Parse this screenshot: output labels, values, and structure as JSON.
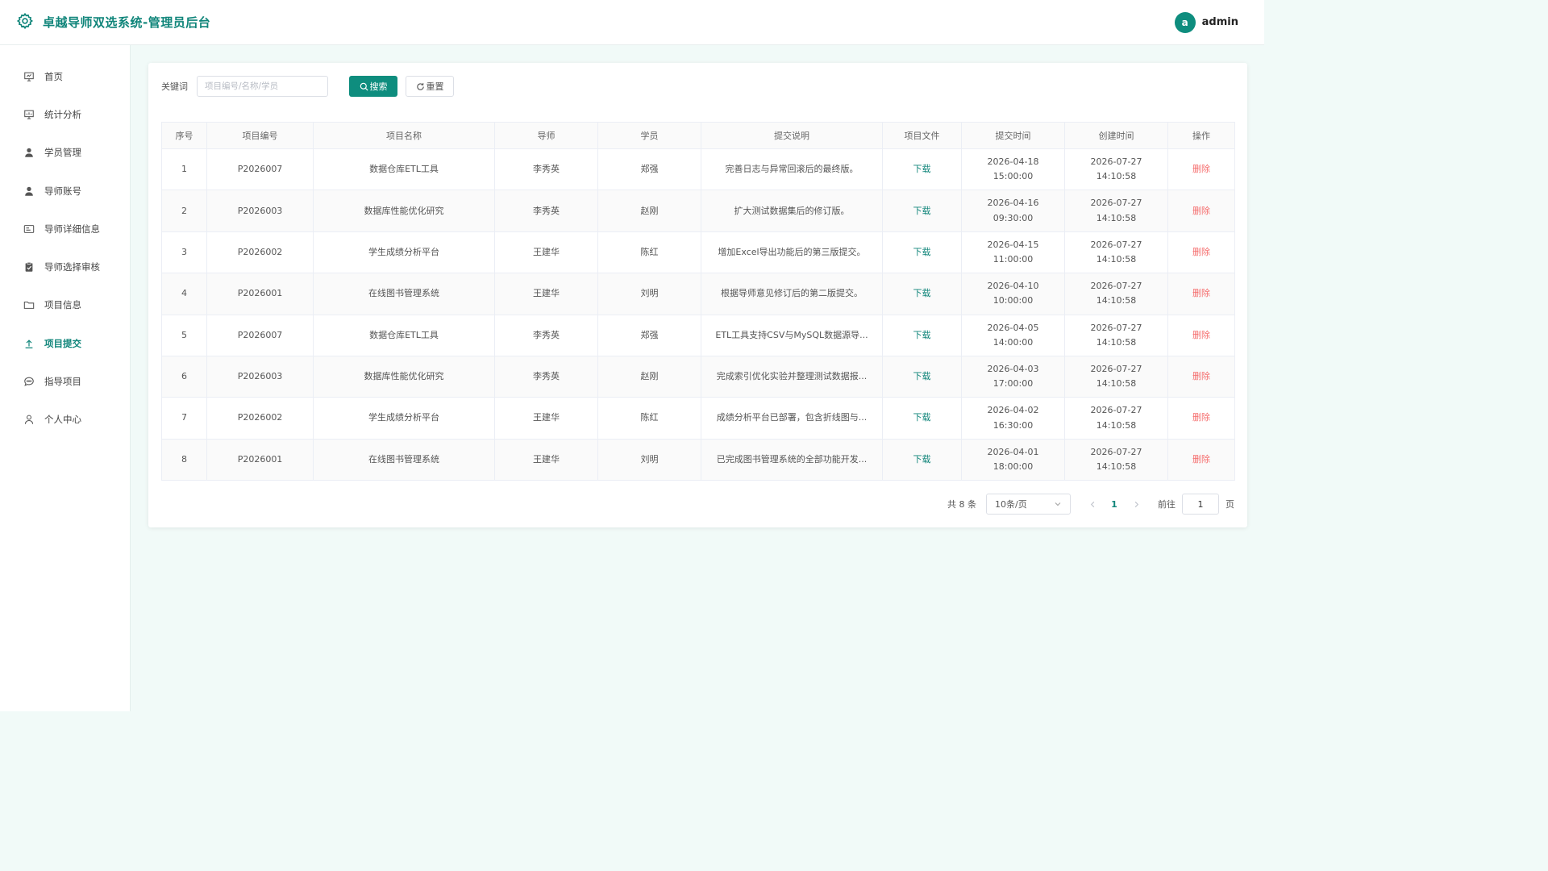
{
  "app": {
    "title": "卓越导师双选系统-管理员后台",
    "user": {
      "avatar_letter": "a",
      "name": "admin"
    }
  },
  "colors": {
    "accent": "#10857a",
    "button": "#0e8d7e",
    "danger": "#f56c6c",
    "background": "#f1faf8"
  },
  "sidebar": {
    "items": [
      {
        "label": "首页",
        "icon": "presentation-board-icon",
        "active": false
      },
      {
        "label": "统计分析",
        "icon": "presentation-chart-icon",
        "active": false
      },
      {
        "label": "学员管理",
        "icon": "user-solid-icon",
        "active": false
      },
      {
        "label": "导师账号",
        "icon": "user-solid-icon",
        "active": false
      },
      {
        "label": "导师详细信息",
        "icon": "id-card-icon",
        "active": false
      },
      {
        "label": "导师选择审核",
        "icon": "clipboard-check-icon",
        "active": false
      },
      {
        "label": "项目信息",
        "icon": "folder-icon",
        "active": false
      },
      {
        "label": "项目提交",
        "icon": "upload-icon",
        "active": true
      },
      {
        "label": "指导项目",
        "icon": "chat-bubble-icon",
        "active": false
      },
      {
        "label": "个人中心",
        "icon": "user-outline-icon",
        "active": false
      }
    ]
  },
  "filter": {
    "label": "关键词",
    "placeholder": "项目编号/名称/学员",
    "value": "",
    "search_label": "搜索",
    "reset_label": "重置"
  },
  "table": {
    "columns": [
      "序号",
      "项目编号",
      "项目名称",
      "导师",
      "学员",
      "提交说明",
      "项目文件",
      "提交时间",
      "创建时间",
      "操作"
    ],
    "download_label": "下载",
    "delete_label": "删除",
    "rows": [
      {
        "index": "1",
        "code": "P2026007",
        "name": "数据仓库ETL工具",
        "mentor": "李秀英",
        "student": "郑强",
        "note": "完善日志与异常回滚后的最终版。",
        "submit_date": "2026-04-18",
        "submit_time": "15:00:00",
        "create_date": "2026-07-27",
        "create_time": "14:10:58"
      },
      {
        "index": "2",
        "code": "P2026003",
        "name": "数据库性能优化研究",
        "mentor": "李秀英",
        "student": "赵刚",
        "note": "扩大测试数据集后的修订版。",
        "submit_date": "2026-04-16",
        "submit_time": "09:30:00",
        "create_date": "2026-07-27",
        "create_time": "14:10:58"
      },
      {
        "index": "3",
        "code": "P2026002",
        "name": "学生成绩分析平台",
        "mentor": "王建华",
        "student": "陈红",
        "note": "增加Excel导出功能后的第三版提交。",
        "submit_date": "2026-04-15",
        "submit_time": "11:00:00",
        "create_date": "2026-07-27",
        "create_time": "14:10:58"
      },
      {
        "index": "4",
        "code": "P2026001",
        "name": "在线图书管理系统",
        "mentor": "王建华",
        "student": "刘明",
        "note": "根据导师意见修订后的第二版提交。",
        "submit_date": "2026-04-10",
        "submit_time": "10:00:00",
        "create_date": "2026-07-27",
        "create_time": "14:10:58"
      },
      {
        "index": "5",
        "code": "P2026007",
        "name": "数据仓库ETL工具",
        "mentor": "李秀英",
        "student": "郑强",
        "note": "ETL工具支持CSV与MySQL数据源导...",
        "submit_date": "2026-04-05",
        "submit_time": "14:00:00",
        "create_date": "2026-07-27",
        "create_time": "14:10:58"
      },
      {
        "index": "6",
        "code": "P2026003",
        "name": "数据库性能优化研究",
        "mentor": "李秀英",
        "student": "赵刚",
        "note": "完成索引优化实验并整理测试数据报...",
        "submit_date": "2026-04-03",
        "submit_time": "17:00:00",
        "create_date": "2026-07-27",
        "create_time": "14:10:58"
      },
      {
        "index": "7",
        "code": "P2026002",
        "name": "学生成绩分析平台",
        "mentor": "王建华",
        "student": "陈红",
        "note": "成绩分析平台已部署，包含折线图与...",
        "submit_date": "2026-04-02",
        "submit_time": "16:30:00",
        "create_date": "2026-07-27",
        "create_time": "14:10:58"
      },
      {
        "index": "8",
        "code": "P2026001",
        "name": "在线图书管理系统",
        "mentor": "王建华",
        "student": "刘明",
        "note": "已完成图书管理系统的全部功能开发...",
        "submit_date": "2026-04-01",
        "submit_time": "18:00:00",
        "create_date": "2026-07-27",
        "create_time": "14:10:58"
      }
    ]
  },
  "pagination": {
    "total_label": "共 8 条",
    "page_size": "10条/页",
    "current_page": "1",
    "goto_label": "前往",
    "goto_value": "1",
    "page_suffix": "页"
  }
}
